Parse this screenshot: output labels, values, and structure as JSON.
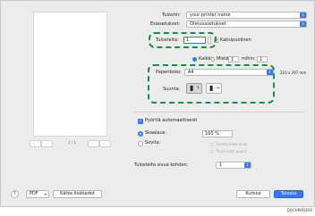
{
  "printer": {
    "label": "Tulostin:",
    "value": "your printer name"
  },
  "presets": {
    "label": "Esiasetukset:",
    "value": "Oletusasetukset"
  },
  "copies": {
    "label": "Tulosteita:",
    "value": "1",
    "duplex_label": "Kaksipuolinen"
  },
  "pages": {
    "all_label": "Kaikki",
    "from_label": "Mistä:",
    "from_value": "1",
    "to_label": "mihin:",
    "to_value": "1"
  },
  "paper_size": {
    "label": "Paperikoko:",
    "value": "A4",
    "dimensions": "210 x 297 mm"
  },
  "orientation": {
    "label": "Suunta:"
  },
  "auto_rotate": {
    "label": "Pyöritä automaattisesti",
    "checked": true
  },
  "scale": {
    "label": "Skaalaus:",
    "value": "100 %"
  },
  "fit": {
    "label": "Sovita:",
    "option1": "Tulosta koko kuva",
    "option2": "Täytä koko paperi"
  },
  "copies_per_page": {
    "label": "Tulosteita sivua kohden:",
    "value": "1"
  },
  "preview": {
    "page_indicator": "1 / 1"
  },
  "footer": {
    "help": "?",
    "pdf": "PDF",
    "details": "Kätke lisätiedot",
    "cancel": "Kumoa",
    "print": "Tulosta"
  },
  "figure_code": "DQCHMA5606",
  "colors": {
    "accent": "#3478f6",
    "highlight": "#10924a"
  }
}
